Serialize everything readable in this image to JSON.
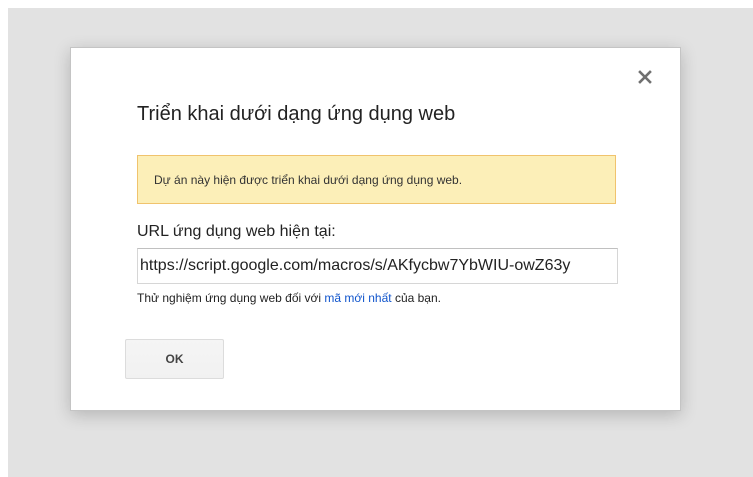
{
  "dialog": {
    "title": "Triển khai dưới dạng ứng dụng web",
    "close_icon": "close-icon",
    "notice": "Dự án này hiện được triển khai dưới dạng ứng dụng web.",
    "url_label": "URL ứng dụng web hiện tại:",
    "url_value": "https://script.google.com/macros/s/AKfycbw7YbWIU-owZ63y",
    "test_prefix": "Thử nghiệm ứng dụng web đối với ",
    "test_link": "mã mới nhất",
    "test_suffix": " của bạn.",
    "ok_label": "OK"
  },
  "colors": {
    "backdrop": "#e2e2e2",
    "notice_bg": "#fcefb8",
    "notice_border": "#f0c36d",
    "link": "#1155cc"
  }
}
